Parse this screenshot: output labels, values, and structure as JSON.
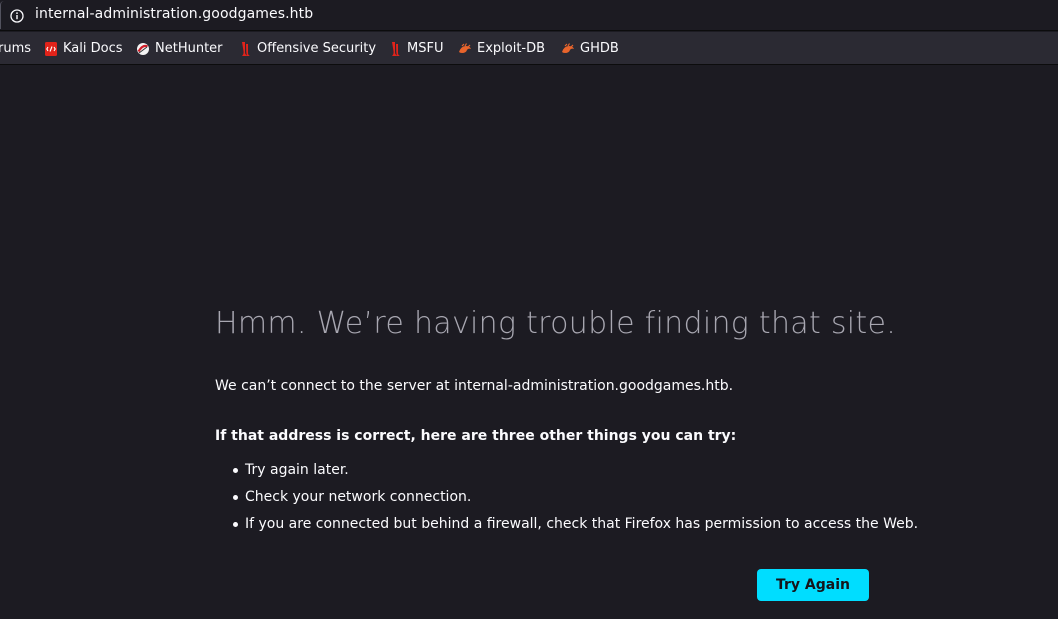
{
  "browser": {
    "url": "internal-administration.goodgames.htb",
    "bookmarks": [
      {
        "label": "rums",
        "icon": "kali-forums-icon"
      },
      {
        "label": "Kali Docs",
        "icon": "kali-docs-icon"
      },
      {
        "label": "NetHunter",
        "icon": "nethunter-icon"
      },
      {
        "label": "Offensive Security",
        "icon": "offsec-icon"
      },
      {
        "label": "MSFU",
        "icon": "msfu-icon"
      },
      {
        "label": "Exploit-DB",
        "icon": "exploit-db-icon"
      },
      {
        "label": "GHDB",
        "icon": "ghdb-icon"
      }
    ]
  },
  "error_page": {
    "title": "Hmm. We’re having trouble finding that site.",
    "description": "We can’t connect to the server at internal-administration.goodgames.htb.",
    "suggestions_heading": "If that address is correct, here are three other things you can try:",
    "suggestions": [
      "Try again later.",
      "Check your network connection.",
      "If you are connected but behind a firewall, check that Firefox has permission to access the Web."
    ],
    "try_again_label": "Try Again"
  },
  "colors": {
    "page_background": "#1c1b22",
    "toolbar_background": "#2b2a33",
    "title_text": "#a8a7b1",
    "body_text": "#fbfbfe",
    "primary_button": "#00ddff"
  }
}
